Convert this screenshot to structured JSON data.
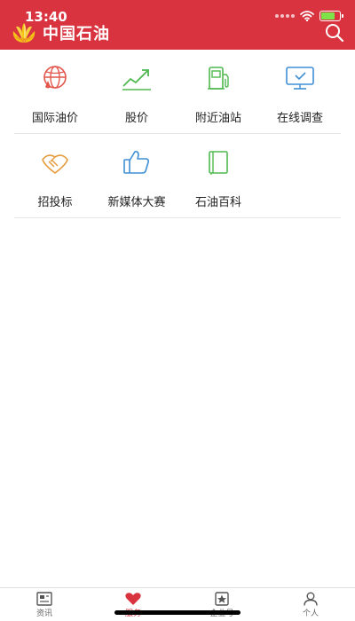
{
  "status_bar": {
    "time": "13:40"
  },
  "header": {
    "title": "中国石油",
    "search_icon": "search-icon"
  },
  "colors": {
    "brand": "#d8333f",
    "red_icon": "#e2564c",
    "green_icon": "#4fb84f",
    "blue_icon": "#3f8fd6",
    "orange_icon": "#e69a3a"
  },
  "services": {
    "rows": [
      [
        {
          "label": "国际油价",
          "icon": "globe-drop-icon"
        },
        {
          "label": "股价",
          "icon": "trend-up-icon"
        },
        {
          "label": "附近油站",
          "icon": "fuel-pump-icon"
        },
        {
          "label": "在线调查",
          "icon": "monitor-check-icon"
        }
      ],
      [
        {
          "label": "招投标",
          "icon": "handshake-icon"
        },
        {
          "label": "新媒体大赛",
          "icon": "thumbs-up-icon"
        },
        {
          "label": "石油百科",
          "icon": "book-icon"
        }
      ]
    ]
  },
  "tabbar": {
    "tabs": [
      {
        "label": "资讯",
        "icon": "newspaper-icon"
      },
      {
        "label": "服务",
        "icon": "heart-icon",
        "active": true
      },
      {
        "label": "企业号",
        "icon": "star-badge-icon"
      },
      {
        "label": "个人",
        "icon": "person-icon"
      }
    ]
  }
}
